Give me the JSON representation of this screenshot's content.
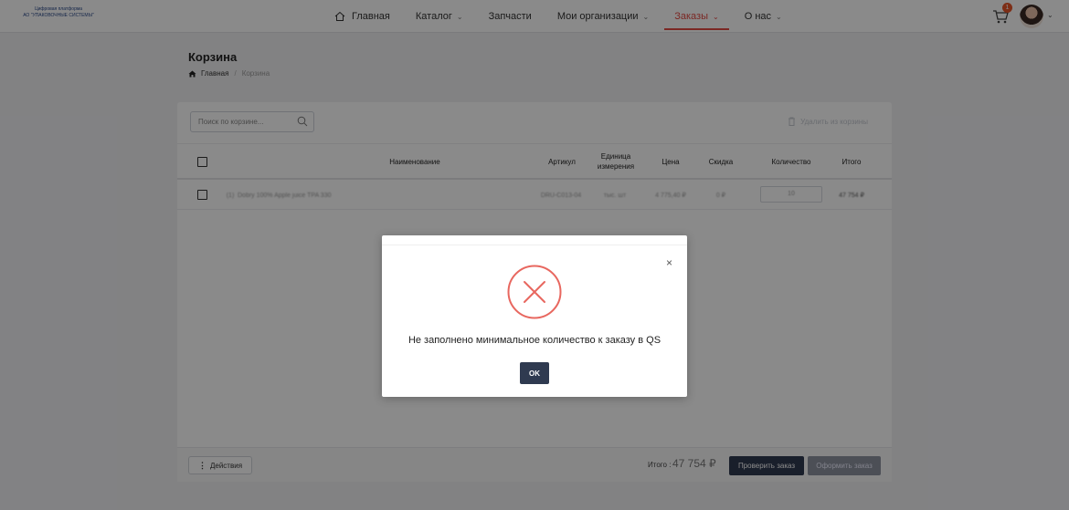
{
  "header": {
    "logo_line1": "Цифровая платформа",
    "logo_line2": "АО \"УПАКОВОЧНЫЕ СИСТЕМЫ\"",
    "nav": [
      {
        "label": "Главная"
      },
      {
        "label": "Каталог"
      },
      {
        "label": "Запчасти"
      },
      {
        "label": "Мои организации"
      },
      {
        "label": "Заказы"
      },
      {
        "label": "О нас"
      }
    ],
    "cart_count": "1",
    "accent_color": "#e34b44"
  },
  "page": {
    "title": "Корзина",
    "breadcrumb": {
      "home": "Главная",
      "separator": "/",
      "current": "Корзина"
    }
  },
  "toolbar": {
    "search_placeholder": "Поиск по корзине...",
    "delete_label": "Удалить из корзины"
  },
  "table": {
    "headers": {
      "name": "Наименование",
      "article": "Артикул",
      "unit_line1": "Единица",
      "unit_line2": "измерения",
      "price": "Цена",
      "discount": "Скидка",
      "quantity": "Количество",
      "total": "Итого"
    },
    "rows": [
      {
        "index": "(1)",
        "name": "Dobry 100% Apple juice TPA 330",
        "article": "DRU-C013-04",
        "unit": "тыс. шт",
        "price": "4 775,40 ₽",
        "discount": "0 ₽",
        "quantity": "10",
        "total": "47 754 ₽"
      }
    ]
  },
  "footer": {
    "actions_label": "Действия",
    "total_label": "Итого :",
    "total_value": "47 754 ₽",
    "check_label": "Проверить заказ",
    "order_label": "Оформить заказ"
  },
  "modal": {
    "message": "Не заполнено минимальное количество к заказу в QS",
    "ok_label": "OK",
    "close_glyph": "×",
    "icon": "error-circle-icon",
    "icon_color": "#e8675f"
  }
}
